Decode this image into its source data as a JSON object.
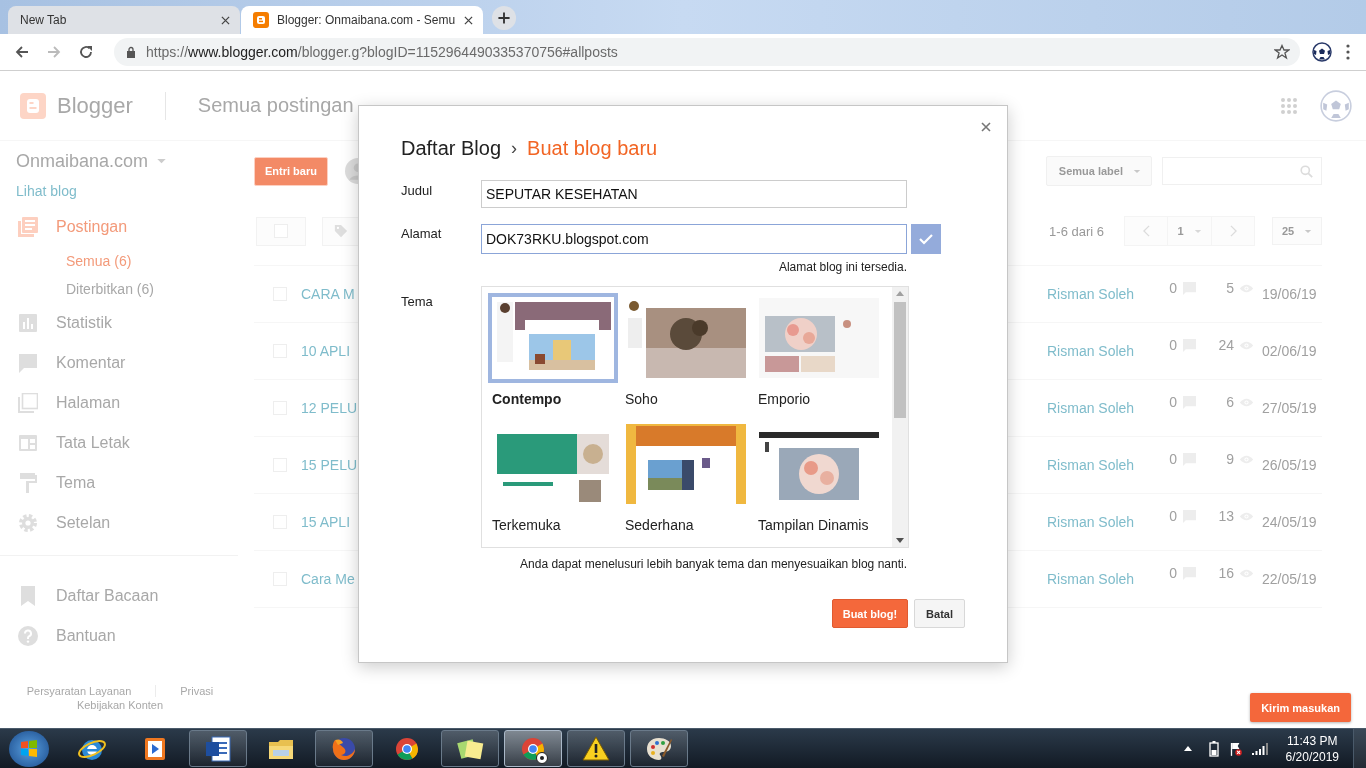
{
  "browser": {
    "tabs": [
      {
        "title": "New Tab",
        "selected": false
      },
      {
        "title": "Blogger: Onmaibana.com - Semu",
        "selected": true
      }
    ],
    "forward_disabled": true,
    "address": {
      "scheme": "https://",
      "host": "www.blogger.com",
      "path": "/blogger.g?blogID=1152964490335370756#allposts"
    }
  },
  "header": {
    "brand": "Blogger",
    "page_title": "Semua postingan"
  },
  "sidebar": {
    "blog_name": "Onmaibana.com",
    "view_link": "Lihat blog",
    "items": [
      {
        "kind": "posts",
        "label": "Postingan",
        "selected": true,
        "children": [
          {
            "label": "Semua (6)",
            "selected": true
          },
          {
            "label": "Diterbitkan (6)",
            "selected": false
          }
        ]
      },
      {
        "kind": "stats",
        "label": "Statistik",
        "selected": false
      },
      {
        "kind": "comments",
        "label": "Komentar",
        "selected": false
      },
      {
        "kind": "pages",
        "label": "Halaman",
        "selected": false
      },
      {
        "kind": "layout",
        "label": "Tata Letak",
        "selected": false
      },
      {
        "kind": "theme",
        "label": "Tema",
        "selected": false
      },
      {
        "kind": "settings",
        "label": "Setelan",
        "selected": false
      }
    ],
    "secondary": [
      {
        "kind": "reading",
        "label": "Daftar Bacaan"
      },
      {
        "kind": "help",
        "label": "Bantuan"
      }
    ],
    "footer_links": [
      "Persyaratan Layanan",
      "Privasi",
      "Kebijakan Konten"
    ]
  },
  "toolbar": {
    "new_post": "Entri baru",
    "label_filter": "Semua label",
    "range": "1-6 dari 6",
    "page": "1",
    "per_page": "25"
  },
  "posts": [
    {
      "title": "CARA M",
      "author": "Risman Soleh",
      "comments": "0",
      "views": "5",
      "date": "19/06/19",
      "checked": false
    },
    {
      "title": "10 APLI",
      "author": "Risman Soleh",
      "comments": "0",
      "views": "24",
      "date": "02/06/19",
      "checked": false
    },
    {
      "title": "12 PELU",
      "author": "Risman Soleh",
      "comments": "0",
      "views": "6",
      "date": "27/05/19",
      "checked": false
    },
    {
      "title": "15 PELU",
      "author": "Risman Soleh",
      "comments": "0",
      "views": "9",
      "date": "26/05/19",
      "checked": false
    },
    {
      "title": "15 APLI",
      "author": "Risman Soleh",
      "comments": "0",
      "views": "13",
      "date": "24/05/19",
      "checked": false
    },
    {
      "title": "Cara Me",
      "author": "Risman Soleh",
      "comments": "0",
      "views": "16",
      "date": "22/05/19",
      "checked": false
    }
  ],
  "dialog": {
    "breadcrumb": "Daftar Blog",
    "separator": "›",
    "title": "Buat blog baru",
    "title_field": {
      "label": "Judul",
      "value": "SEPUTAR KESEHATAN"
    },
    "address_field": {
      "label": "Alamat",
      "value": "DOK73RKU.blogspot.com",
      "focused": true,
      "available": true,
      "note": "Alamat blog ini tersedia."
    },
    "theme_label": "Tema",
    "themes": [
      {
        "name": "Contempo",
        "selected": true
      },
      {
        "name": "Soho",
        "selected": false
      },
      {
        "name": "Emporio",
        "selected": false
      },
      {
        "name": "Terkemuka",
        "selected": false
      },
      {
        "name": "Sederhana",
        "selected": false
      },
      {
        "name": "Tampilan Dinamis",
        "selected": false
      }
    ],
    "hint": "Anda dapat menelusuri lebih banyak tema dan menyesuaikan blog nanti.",
    "buttons": [
      {
        "label": "Buat blog!",
        "kind": "primary"
      },
      {
        "label": "Batal",
        "kind": "secondary"
      }
    ]
  },
  "feedback_button": "Kirim masukan",
  "taskbar": {
    "apps": [
      {
        "kind": "ie",
        "running": false,
        "selected": false
      },
      {
        "kind": "media",
        "running": false,
        "selected": false
      },
      {
        "kind": "word",
        "running": true,
        "selected": false
      },
      {
        "kind": "explorer",
        "running": false,
        "selected": false
      },
      {
        "kind": "firefox",
        "running": true,
        "selected": false
      },
      {
        "kind": "chrome",
        "running": false,
        "selected": false
      },
      {
        "kind": "notes",
        "running": true,
        "selected": false
      },
      {
        "kind": "chrome_ball",
        "running": true,
        "selected": true
      },
      {
        "kind": "warning",
        "running": true,
        "selected": false
      },
      {
        "kind": "paint",
        "running": true,
        "selected": false
      }
    ],
    "clock": {
      "time": "11:43 PM",
      "date": "6/20/2019"
    }
  }
}
